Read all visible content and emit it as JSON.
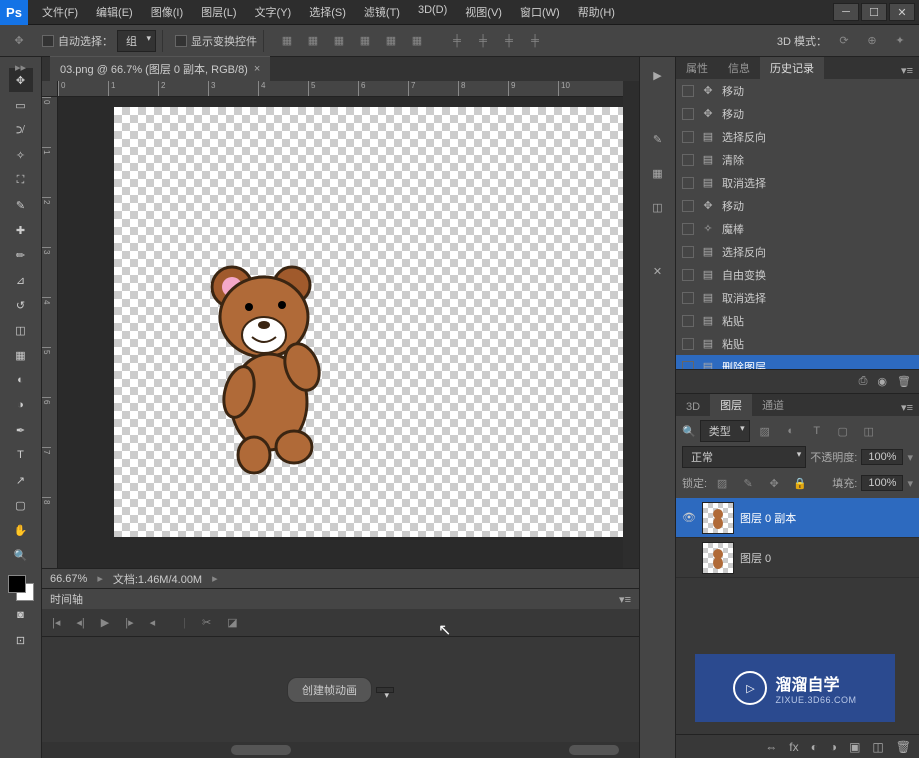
{
  "app": {
    "logo": "Ps"
  },
  "menu": [
    "文件(F)",
    "编辑(E)",
    "图像(I)",
    "图层(L)",
    "文字(Y)",
    "选择(S)",
    "滤镜(T)",
    "3D(D)",
    "视图(V)",
    "窗口(W)",
    "帮助(H)"
  ],
  "options": {
    "auto_select": "自动选择：",
    "group": "组",
    "show_transform": "显示变换控件",
    "mode_3d": "3D 模式："
  },
  "doc_tab": {
    "title": "03.png @ 66.7% (图层 0 副本, RGB/8)",
    "close": "×"
  },
  "ruler_h": [
    "0",
    "1",
    "2",
    "3",
    "4",
    "5",
    "6",
    "7",
    "8",
    "9",
    "10"
  ],
  "ruler_v": [
    "0",
    "1",
    "2",
    "3",
    "4",
    "5",
    "6",
    "7",
    "8"
  ],
  "status": {
    "zoom": "66.67%",
    "doc_info": "文档:1.46M/4.00M"
  },
  "timeline": {
    "title": "时间轴",
    "create_btn": "创建帧动画"
  },
  "panels_top": {
    "tabs": [
      "属性",
      "信息",
      "历史记录"
    ],
    "active_tab": 2,
    "history": [
      {
        "icon": "move",
        "label": "移动"
      },
      {
        "icon": "move",
        "label": "移动"
      },
      {
        "icon": "doc",
        "label": "选择反向"
      },
      {
        "icon": "doc",
        "label": "清除"
      },
      {
        "icon": "doc",
        "label": "取消选择"
      },
      {
        "icon": "move",
        "label": "移动"
      },
      {
        "icon": "wand",
        "label": "魔棒"
      },
      {
        "icon": "doc",
        "label": "选择反向"
      },
      {
        "icon": "doc",
        "label": "自由变换"
      },
      {
        "icon": "doc",
        "label": "取消选择"
      },
      {
        "icon": "doc",
        "label": "粘贴"
      },
      {
        "icon": "doc",
        "label": "粘贴"
      },
      {
        "icon": "doc",
        "label": "删除图层",
        "sel": true
      }
    ]
  },
  "panels_mid": {
    "tabs": [
      "3D",
      "图层",
      "通道"
    ],
    "active_tab": 1,
    "kind": "类型",
    "blend": "正常",
    "opacity_label": "不透明度:",
    "opacity": "100%",
    "lock_label": "锁定:",
    "fill_label": "填充:",
    "fill": "100%",
    "layers": [
      {
        "name": "图层 0 副本",
        "sel": true,
        "eye": true,
        "bear": true
      },
      {
        "name": "图层 0",
        "sel": false,
        "eye": false,
        "bear": true
      }
    ]
  },
  "watermark": {
    "line1": "溜溜自学",
    "line2": "ZIXUE.3D66.COM"
  }
}
